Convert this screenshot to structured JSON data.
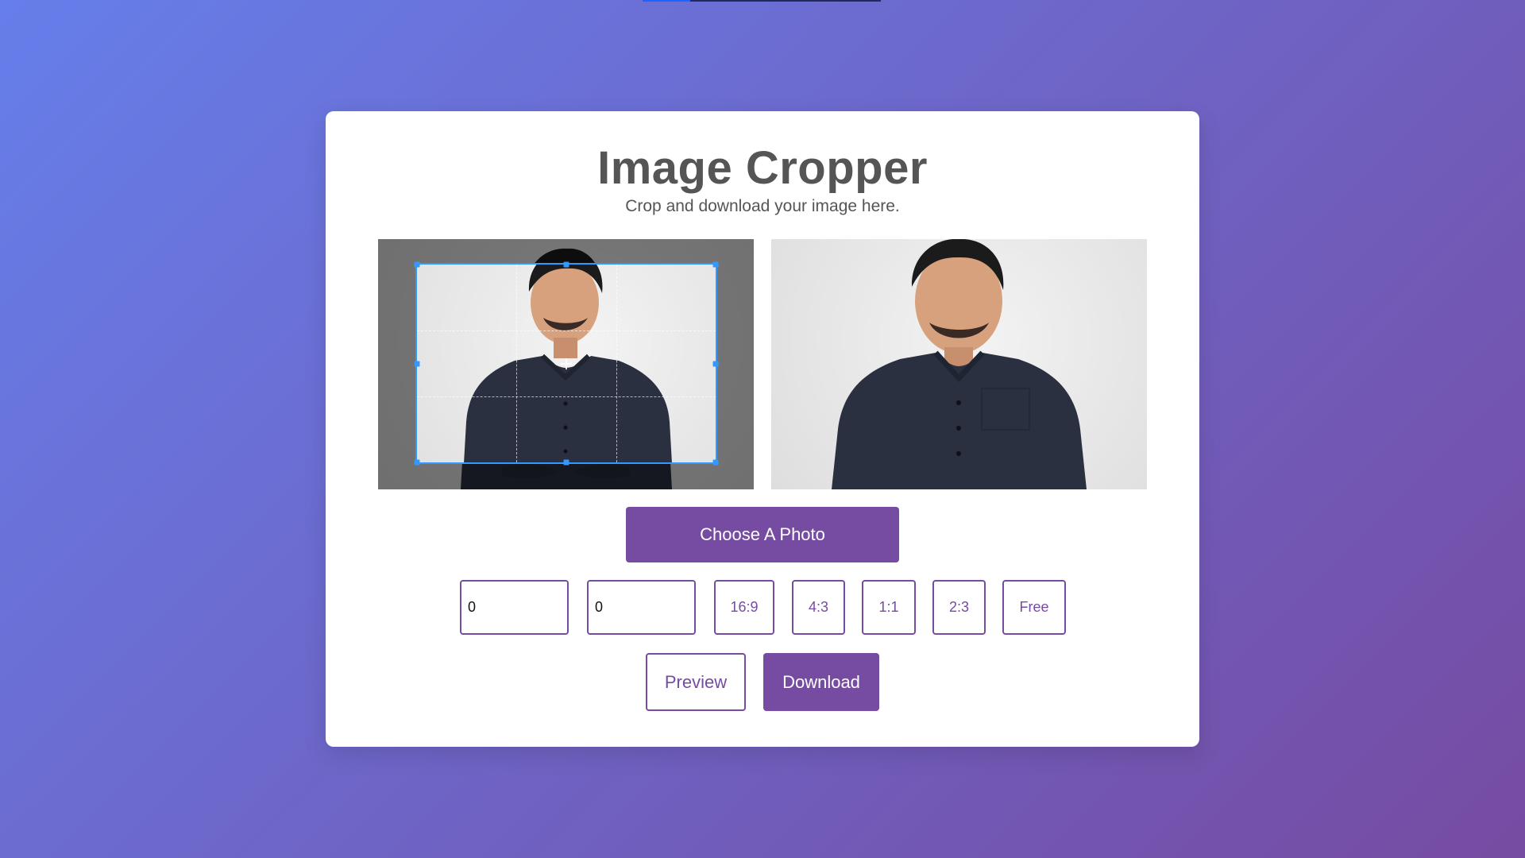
{
  "page": {
    "title": "Image Cropper",
    "subtitle": "Crop and download your image here."
  },
  "colors": {
    "gradient_start": "#667eea",
    "gradient_end": "#764ba2",
    "accent": "#764ba2",
    "crop_outline": "#3399ff",
    "text": "#555555"
  },
  "cropper": {
    "source_panel_name": "source-image",
    "preview_panel_name": "preview-image",
    "icon_names": [
      "crop-handle-icon",
      "crop-center-icon"
    ]
  },
  "actions": {
    "choose_photo_label": "Choose A Photo",
    "width_value": "0",
    "height_value": "0",
    "ratios": [
      "16:9",
      "4:3",
      "1:1",
      "2:3",
      "Free"
    ],
    "preview_label": "Preview",
    "download_label": "Download"
  }
}
